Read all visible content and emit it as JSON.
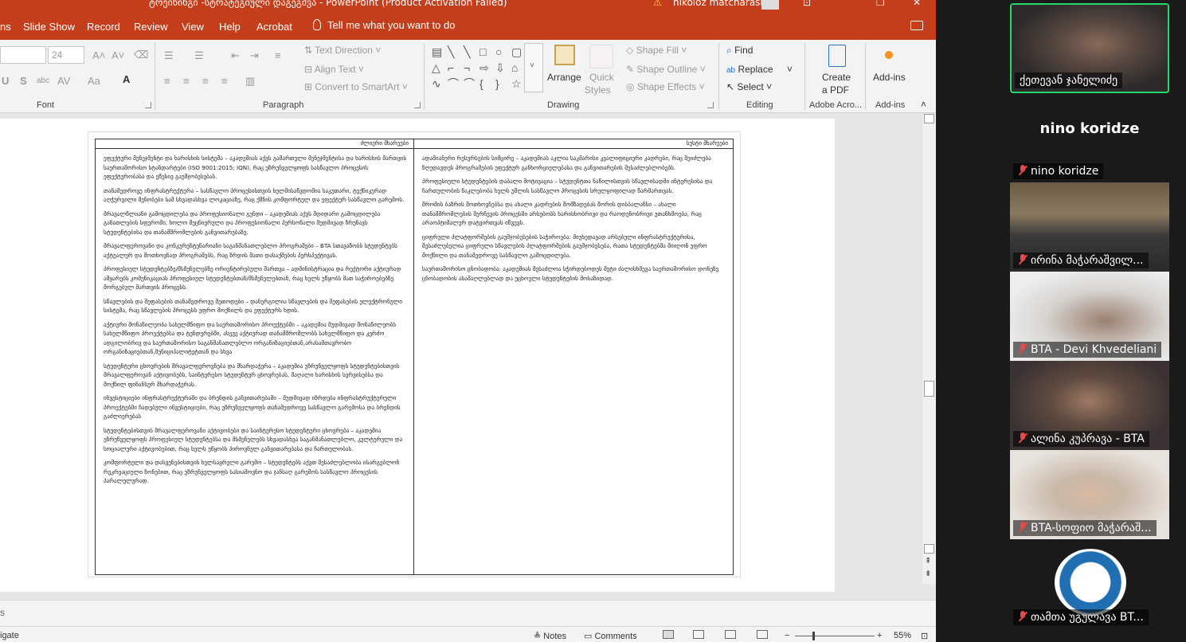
{
  "powerpoint": {
    "title": "ტრეინინგი -სტრატეგიული დაგეგმვა  -  PowerPoint (Product Activation Failed)",
    "user": "nikoloz matcharashvili",
    "tabs": [
      "ns",
      "Slide Show",
      "Record",
      "Review",
      "View",
      "Help",
      "Acrobat"
    ],
    "tell_me": "Tell me what you want to do",
    "ribbon": {
      "font_size": "24",
      "font_group": "Font",
      "paragraph_group": "Paragraph",
      "text_direction": "Text Direction",
      "align_text": "Align Text",
      "convert_smartart": "Convert to SmartArt",
      "drawing_group": "Drawing",
      "arrange": "Arrange",
      "quick_styles_1": "Quick",
      "quick_styles_2": "Styles",
      "shape_fill": "Shape Fill",
      "shape_outline": "Shape Outline",
      "shape_effects": "Shape Effects",
      "find": "Find",
      "replace": "Replace",
      "select": "Select",
      "editing_group": "Editing",
      "create_pdf_1": "Create",
      "create_pdf_2": "a PDF",
      "adobe_group": "Adobe Acro...",
      "addins": "Add-ins",
      "addins_group": "Add-ins"
    },
    "slide": {
      "left_header": "ძლიერი მხარეები",
      "right_header": "სუსტი მხარეები",
      "left_items": [
        "ეფექტური მენეჯმენტი და ხარისხის სისტემა – აკადემიას აქვს გამართული მენეჯმენტისა და ხარისხის მართვის საერთაშორისო სტანდარტები (ISO 9001:2015; IQN), რაც უზრუნველყოფს სასწავლო პროცესის ეფექტურობასა და ეწესივ გაუმჯობესებას.",
        "თანამედროვე ინფრასტრუქტურა – სასწავლო პროცესისთვის ხელმისაწვდომია საკუთარი, ტექნიკურად აღჭურვილი შენობები სამ სხვადასხვა ლოკაციაზე, რაც ქმნის კომფორტულ და ეფექტურ სასწავლო გარემოს.",
        "მრავალწლიანი გამოცდილება და პროფესიონალი გუნდი – აკადემიას აქვს მდიდარი გამოცდილება განათლების სფეროში, ხოლო მეცნიერული და პროფესიონალი პერსონალი მუდმივად ზრუნავს სტუდენტებისა და თანამშრომლების განვითარებაზე.",
        "მრავალფეროვანი და კონკურენტუნარიანი საგანმანათლებლო პროგრამები – BTA სთავაზობს სტუდენტებს აქტუალურ და მოთხოვნად პროგრამებს, რაც ზრდის მათი დასაქმების პერსპექტივას.",
        "პროფესიულ სტუდენტებზე/მსმენელებზე ორიენტირებული მართვა – ადმინისტრაცია და რექტორი აქტიურად ამყარებს კომუნიკაციას პროფესიულ სტუდენტებთან/მსმენელებთან, რაც ხელს უწყობს მათ საჭიროებებზე მორგებულ მართვის პროცესს.",
        "სწავლების და შეფასების თანამედროვე მეთოდები – დანერგილია სწავლების და შეფასების ელექტრონული სისტემა, რაც სწავლების პროცესს უფრო მოქნილს და ეფექტურს ხდის.",
        "აქტიური მონაწილეობა სახელმწიფო და საერთაშორისო პროექტებში – აკადემია მუდმივად მონაწილეობს სახელმწიფო პროექტებსა და ტენდერებში, ასევე აქტიურად თანამშრომლობს სახელმწიფო და კერძო ადგილობრივ და საერთაშორისო საგანმანათლებლო ორგანიზაციებთან,არასამთავრობო ორგანიზაციებთან,მუნიციპალიტეტთან და სხვა",
        "სტუდენტური ცხოვრების მრავალფეროვნება და მხარდაჭერა – აკადემია უზრუნველყოფს სტუდენტებისთვის მრავალფეროვან აქტივობებს, საინტერესო სტუდენტურ ცხოვრებას, მაღალი ხარისხის სერვისებსა და მოქნილ ფინანსურ მხარდაჭერას.",
        "ინვესტიციები ინფრასტრუქტურაში და ბრენდის განვითარებაში – მუდმივად იზრდება ინფრასტრუქტურული პროექტებში ჩადებული ინვესტიციები, რაც უზრუნველყოფს თანამედროვე სასწავლო გარემოსა და ბრენდის გაძლიერებას",
        "სტუდენტებისთვის მრავალფეროვანი აქტივობები და საინტერესო სტუდენტური ცხოვრება – აკადემია უზრუნველყოფს პროფესიულ სტუდენტებსა და მსმენელებს სხვადასხვა საგანმანათლებლო, კულტურული და სოციალური აქტივობებით, რაც ხელს უწყობს პიროვნულ განვითარებასა და ჩართულობას.",
        "კომფორტული და დასვენებისთვის ხელსაყრელი გარემო – სტუდენტებს აქვთ შესაძლებლობა ისარგებლონ რეკრეაციული ზონებით, რაც უზრუნველყოფს სასიამოვნო და ჯანსაღ გარემოს სასწავლო პროცესის პარალელურად."
      ],
      "right_items": [
        "ადამიანური რესურსების სიმცირე – აკადემიას აკლია საკმარისი კვალიფიციური კადრები, რაც შეიძლება ზღუდავდეს პროგრამების ეფექტურ განხორციელებასა და განვითარების შესაძლებლობებს.",
        "პროფესიული სტუდენტების დაბალი მოტივაცია – სტუდენტთა ნაწილისთვის სწავლისადმი ინტერესისა და ჩართულობის ნაკლებობა ხელს უშლის სასწავლო პროცესის სრულყოფილად წარმართვას.",
        "შრომის ბაზრის მოთხოვნებსა და ახალი კადრების მომზადებას შორის დისბალანსი – ახალი თანამშრომლების შერჩევის პროცესში არსებობს ხარისხობრივი და რაოდენობრივი უთანხმოება, რაც არაოპტიმალურ დატვირთვას იწვევს.",
        "ციფრული პლატფორმების გაუმჯობესების საჭიროება: მიუხედავად არსებული ინფრასტრუქტურისა, შესაძლებელია ციფრული სწავლების პლატფორმების გაუმჯობესება, რათა სტუდენტებმა მიიღონ უფრო მოქნილი და თანამედროვე სასწავლო გამოცდილება.",
        "საერთაშორისო ცნობადობა: აკადემიას შესაძლოა სჭირდებოდეს მეტი ძალისხმევა საერთაშორისო დონეზე ცნობადობის ასამაღლებლად და უცხოელი სტუდენტების მოსაზიდად."
      ]
    },
    "notes_label": "s",
    "status": {
      "left": "igate",
      "notes": "Notes",
      "comments": "Comments",
      "zoom": "55%"
    }
  },
  "zoom_participants": [
    {
      "name": "ქეთევან ჯანელიძე",
      "muted": false,
      "active": true
    },
    {
      "name": "nino koridze",
      "muted": true,
      "active": false,
      "no_video": true
    },
    {
      "name": "ირინა მაჭარაშვილ...",
      "muted": true,
      "active": false
    },
    {
      "name": "BTA - Devi Khvedeliani",
      "muted": true,
      "active": false
    },
    {
      "name": "ალინა კუპრავა - BTA",
      "muted": true,
      "active": false
    },
    {
      "name": "BTA-სოფიო მაჭარაშ...",
      "muted": true,
      "active": false
    },
    {
      "name": "თამთა უგულავა BT...",
      "muted": true,
      "active": false
    }
  ]
}
